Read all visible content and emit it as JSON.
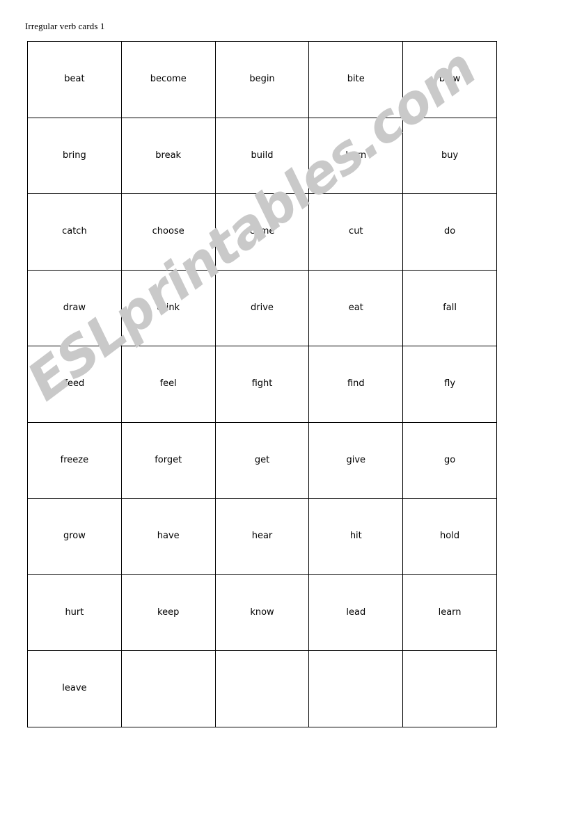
{
  "document": {
    "title": "Irregular verb cards 1"
  },
  "watermark": {
    "text": "ESLprintables.com",
    "color": "#c9c9c9",
    "rotation_deg": -37
  },
  "cards_table": {
    "columns": 5,
    "rows_count": 9,
    "border_color": "#000000",
    "rows": [
      [
        "beat",
        "become",
        "begin",
        "bite",
        "blow"
      ],
      [
        "bring",
        "break",
        "build",
        "burn",
        "buy"
      ],
      [
        "catch",
        "choose",
        "come",
        "cut",
        "do"
      ],
      [
        "draw",
        "drink",
        "drive",
        "eat",
        "fall"
      ],
      [
        "feed",
        "feel",
        "fight",
        "find",
        "fly"
      ],
      [
        "freeze",
        "forget",
        "get",
        "give",
        "go"
      ],
      [
        "grow",
        "have",
        "hear",
        "hit",
        "hold"
      ],
      [
        "hurt",
        "keep",
        "know",
        "lead",
        "learn"
      ],
      [
        "leave",
        "",
        "",
        "",
        ""
      ]
    ]
  }
}
